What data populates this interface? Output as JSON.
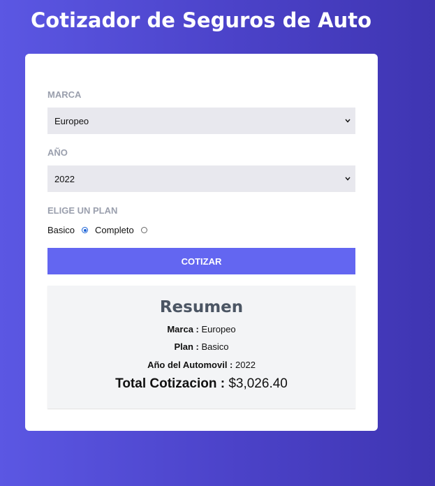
{
  "header": {
    "title": "Cotizador de Seguros de Auto"
  },
  "form": {
    "marca": {
      "label": "Marca",
      "value": "Europeo"
    },
    "anio": {
      "label": "Año",
      "value": "2022"
    },
    "plan": {
      "label": "Elige un Plan",
      "options": [
        {
          "label": "Basico",
          "checked": true
        },
        {
          "label": "Completo",
          "checked": false
        }
      ]
    },
    "submit_label": "Cotizar"
  },
  "resumen": {
    "title": "Resumen",
    "marca_label": "Marca :",
    "marca_value": "Europeo",
    "plan_label": "Plan :",
    "plan_value": "Basico",
    "anio_label": "Año del Automovil :",
    "anio_value": "2022",
    "total_label": "Total Cotizacion :",
    "total_value": "$3,026.40"
  },
  "colors": {
    "background_start": "#5b57e3",
    "background_end": "#3f35b2",
    "button": "#6366f1",
    "field_label": "#9a9fad",
    "select_bg": "#e8e8ee",
    "resumen_bg": "#f3f4f6"
  },
  "icons": {
    "select_arrow": "chevron-down-icon"
  }
}
